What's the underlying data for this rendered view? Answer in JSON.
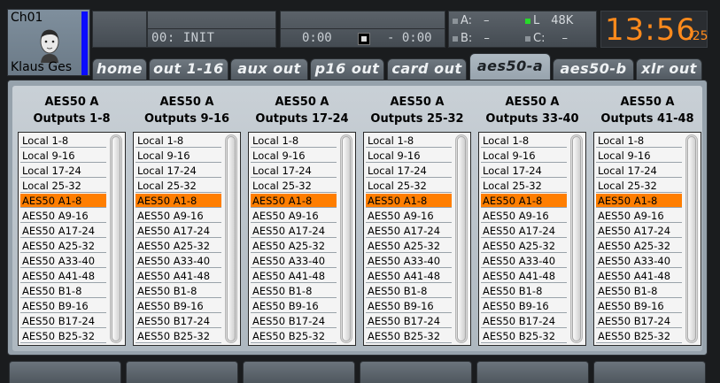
{
  "channel": {
    "id": "Ch01",
    "name": "Klaus Ges",
    "color": "#0a0cff"
  },
  "scene": {
    "title": "00: INIT"
  },
  "tape": {
    "elapsed": "0:00",
    "remaining": "- 0:00"
  },
  "status": {
    "a_label": "A:",
    "a_value": "–",
    "b_label": "B:",
    "b_value": "–",
    "l_label": "L",
    "l_value": "48K",
    "c_label": "C:",
    "c_value": "–"
  },
  "clock": {
    "hm": "13:56",
    "sec": ":25",
    "color": "#ff8a1c"
  },
  "tabs": [
    {
      "label": "home",
      "active": false
    },
    {
      "label": "out 1-16",
      "active": false
    },
    {
      "label": "aux out",
      "active": false
    },
    {
      "label": "p16 out",
      "active": false
    },
    {
      "label": "card out",
      "active": false
    },
    {
      "label": "aes50-a",
      "active": true
    },
    {
      "label": "aes50-b",
      "active": false
    },
    {
      "label": "xlr out",
      "active": false
    }
  ],
  "source_options": [
    "Local 1-8",
    "Local 9-16",
    "Local 17-24",
    "Local 25-32",
    "AES50 A1-8",
    "AES50 A9-16",
    "AES50 A17-24",
    "AES50 A25-32",
    "AES50 A33-40",
    "AES50 A41-48",
    "AES50 B1-8",
    "AES50 B9-16",
    "AES50 B17-24",
    "AES50 B25-32"
  ],
  "columns": [
    {
      "title": "AES50 A",
      "subtitle": "Outputs 1-8",
      "selected": "AES50 A1-8"
    },
    {
      "title": "AES50 A",
      "subtitle": "Outputs 9-16",
      "selected": "AES50 A1-8"
    },
    {
      "title": "AES50 A",
      "subtitle": "Outputs 17-24",
      "selected": "AES50 A1-8"
    },
    {
      "title": "AES50 A",
      "subtitle": "Outputs 25-32",
      "selected": "AES50 A1-8"
    },
    {
      "title": "AES50 A",
      "subtitle": "Outputs 33-40",
      "selected": "AES50 A1-8"
    },
    {
      "title": "AES50 A",
      "subtitle": "Outputs 41-48",
      "selected": "AES50 A1-8"
    }
  ],
  "colors": {
    "selected": "#ff7e00",
    "accent_green": "#27d92a"
  }
}
